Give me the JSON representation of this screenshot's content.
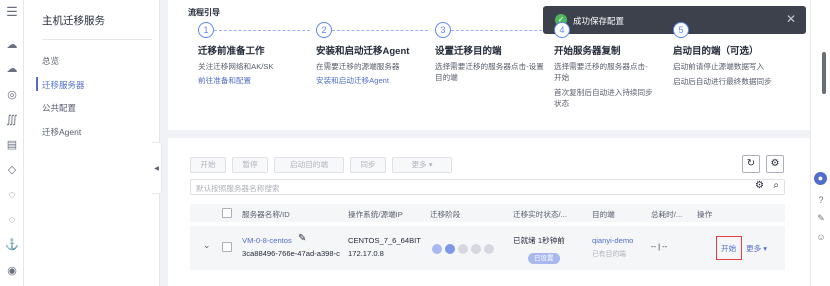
{
  "rail_icons": [
    "menu-icon",
    "cloud-icon",
    "cloud-outline-icon",
    "database-icon",
    "sum-icon",
    "document-icon",
    "cloud-small-icon",
    "cloud-check-icon",
    "cloud-upload-icon",
    "anchor-icon",
    "circle-settings-icon"
  ],
  "sidebar": {
    "title": "主机迁移服务",
    "items": [
      {
        "label": "总览"
      },
      {
        "label": "迁移服务器"
      },
      {
        "label": "公共配置"
      },
      {
        "label": "迁移Agent"
      }
    ]
  },
  "guide": {
    "title": "流程引导",
    "steps": [
      {
        "num": "1",
        "name": "迁移前准备工作",
        "desc": "关注迁移网络和AK/SK",
        "link": "前往准备和配置"
      },
      {
        "num": "2",
        "name": "安装和启动迁移Agent",
        "desc": "在需要迁移的源端服务器",
        "link": "安装和启动迁移Agent"
      },
      {
        "num": "3",
        "name": "设置迁移目的端",
        "desc": "选择需要迁移的服务器点击-设置目的端",
        "link": ""
      },
      {
        "num": "4",
        "name": "开始服务器复制",
        "desc": "选择需要迁移的服务器点击-开始",
        "desc2": "首次复制后自动进入持续同步状态",
        "link": ""
      },
      {
        "num": "5",
        "name": "启动目的端（可选）",
        "desc": "启动前请停止源端数据写入",
        "desc2": "启动后自动进行最终数据同步",
        "link": ""
      }
    ]
  },
  "toast": {
    "text": "成功保存配置",
    "close": "✕"
  },
  "toolbar": {
    "start": "开始",
    "pause": "暂停",
    "launch_target": "启动目的端",
    "sync": "同步",
    "more": "更多 ▾"
  },
  "search": {
    "placeholder": "默认按照服务器名称搜索"
  },
  "table": {
    "headers": [
      "服务器名称/ID",
      "操作系统/源端IP",
      "迁移阶段",
      "迁移实时状态/...",
      "目的端",
      "总耗时/...",
      "操作"
    ],
    "row": {
      "name": "VM-0-8-centos",
      "id": "3ca88496-766e-47ad-a398-c",
      "os": "CENTOS_7_6_64BIT",
      "ip": "172.17.0.8",
      "status": "已就绪  1秒钟前",
      "badge": "已设置",
      "target": "qianyi-demo",
      "target_sub": "已有目的端",
      "time": "-- | --",
      "op_start": "开始",
      "op_more": "更多 ▾"
    }
  },
  "colors": {
    "accent": "#526ecc",
    "highlight": "#e33e3e",
    "toast_bg": "#3d414b",
    "success": "#50b65d"
  }
}
